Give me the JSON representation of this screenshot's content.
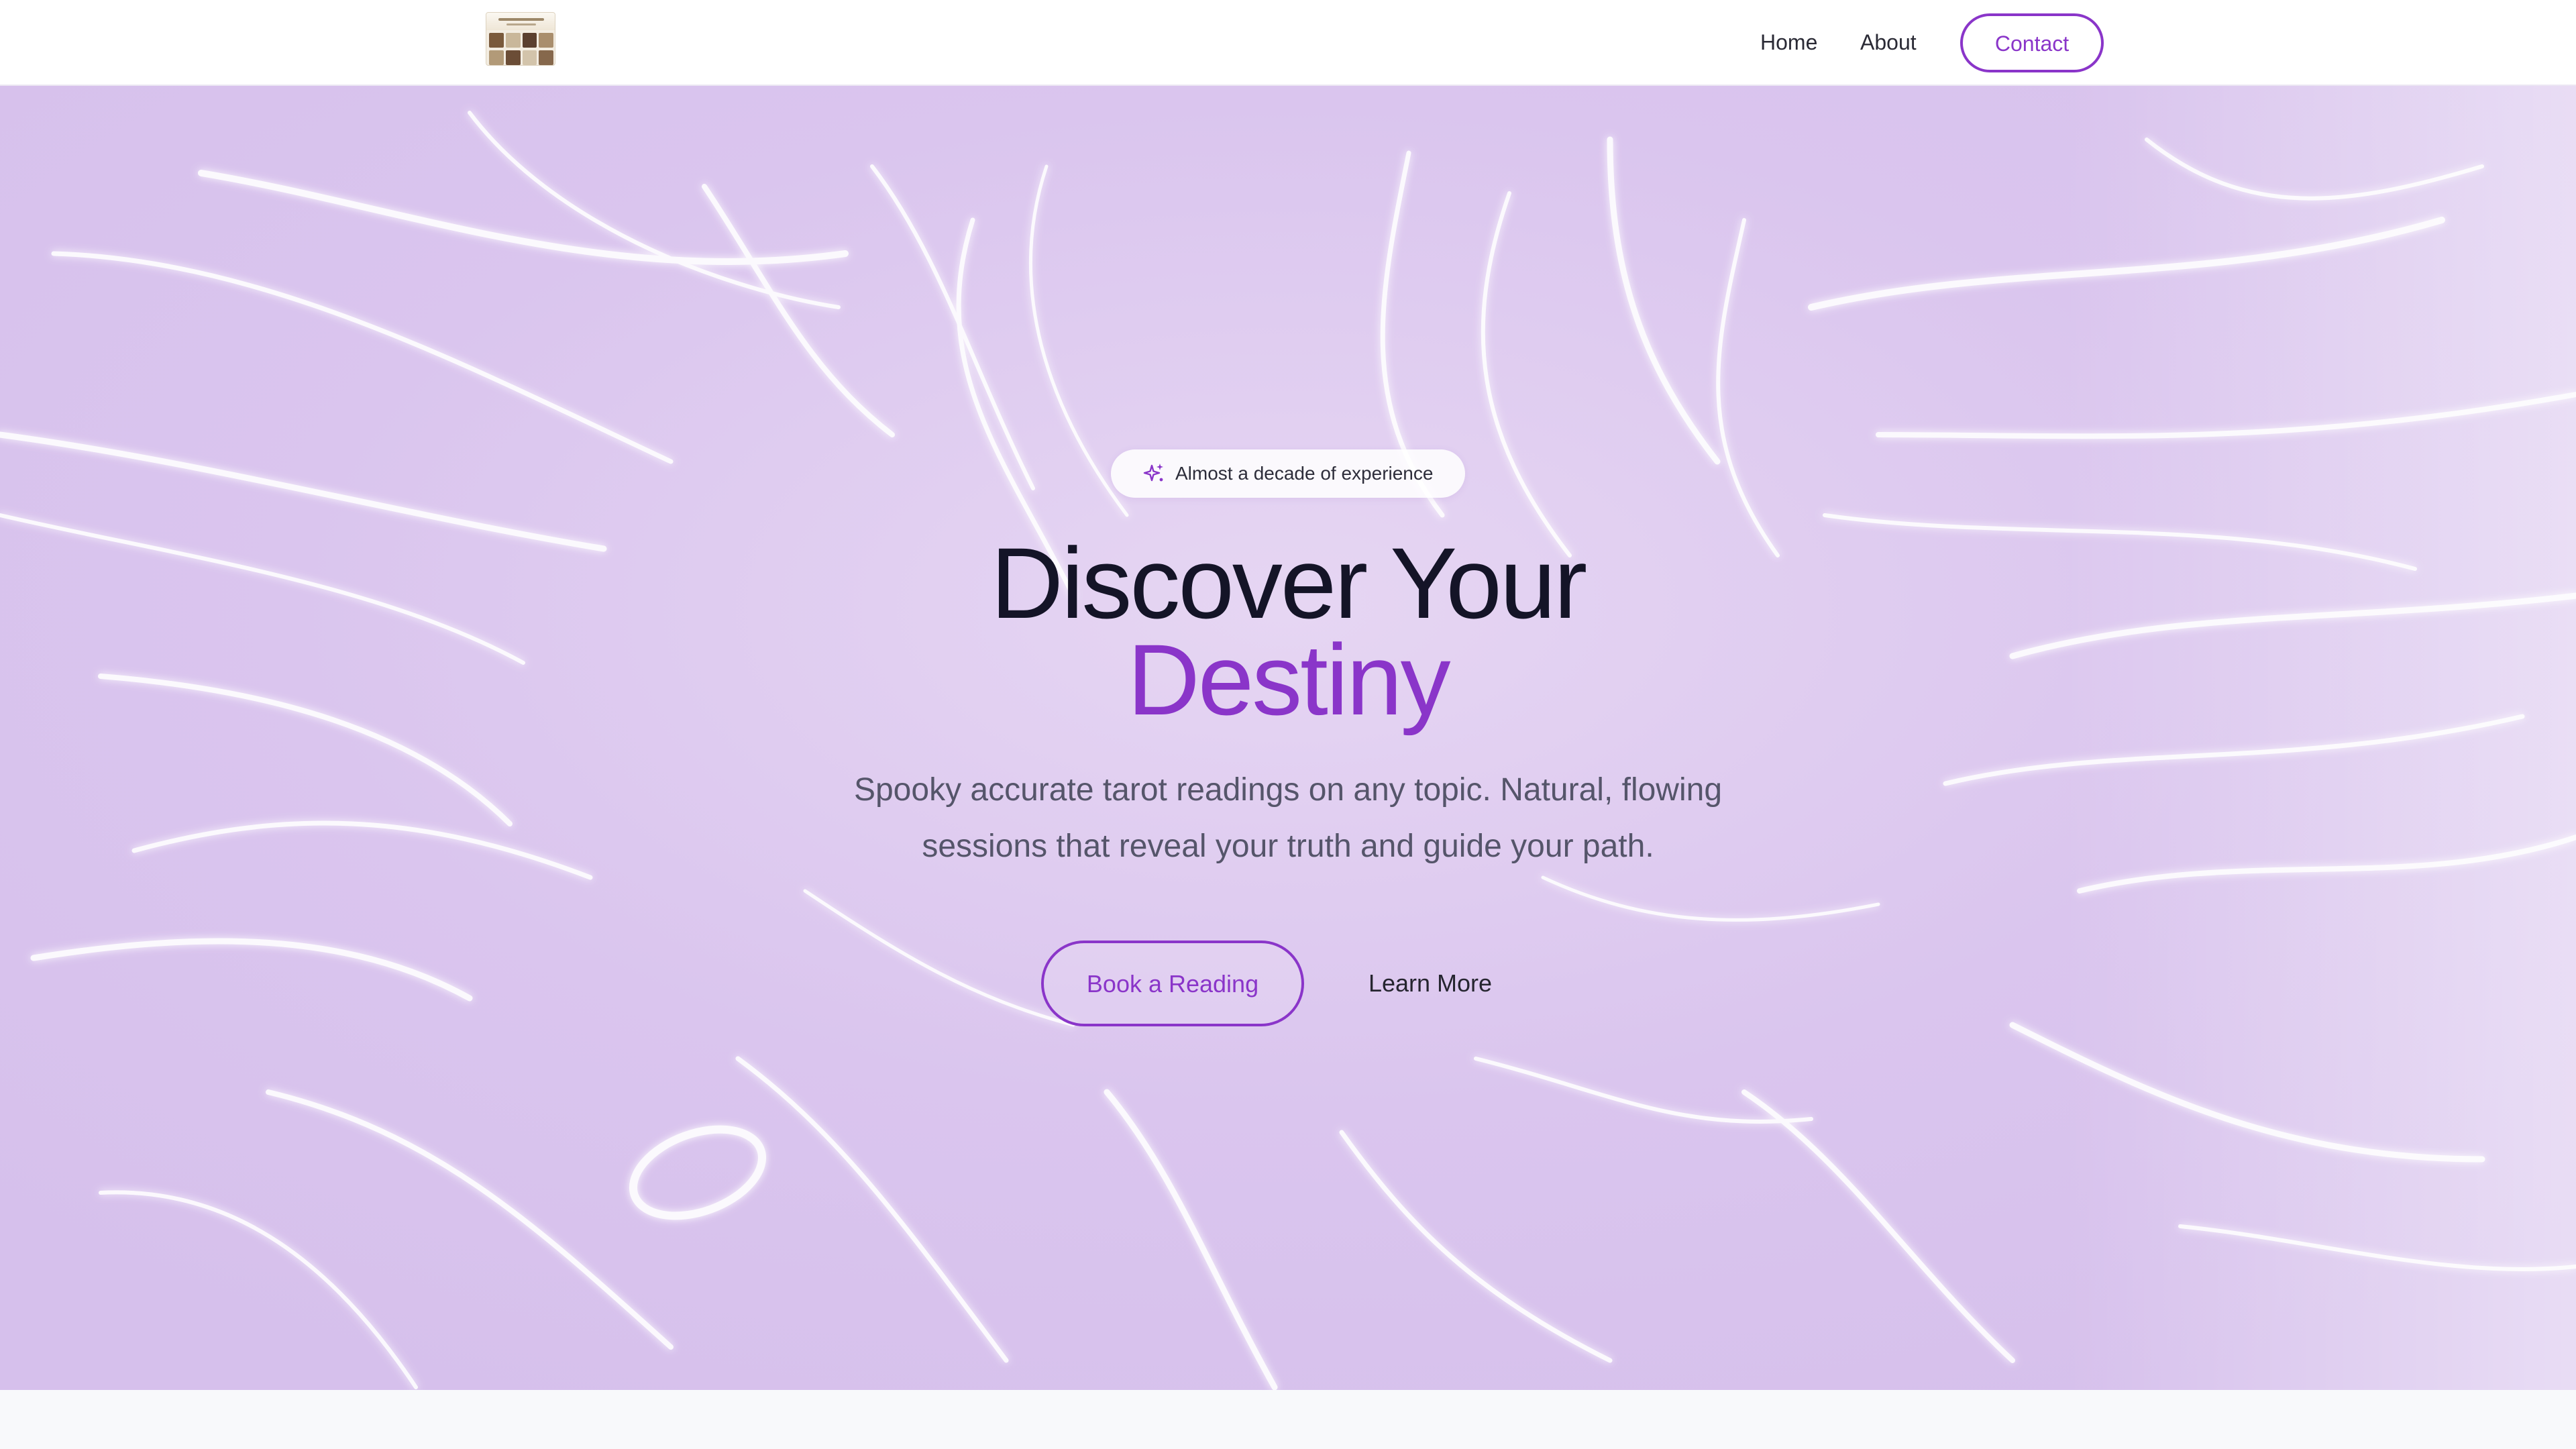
{
  "navbar": {
    "logo_alt": "logo",
    "links": [
      {
        "label": "Home"
      },
      {
        "label": "About"
      }
    ],
    "contact_label": "Contact"
  },
  "hero": {
    "badge_icon": "sparkles-icon",
    "badge_text": "Almost a decade of experience",
    "headline_line1": "Discover Your",
    "headline_line2": "Destiny",
    "subtext": "Spooky accurate tarot readings on any topic. Natural, flowing sessions that reveal your truth and guide your path.",
    "primary_cta": "Book a Reading",
    "secondary_cta": "Learn More"
  },
  "colors": {
    "accent": "#8a35c9",
    "heading": "#141427",
    "body_text": "#55556a",
    "hero_bg": "#dcc8ee",
    "page_bg": "#f8f9fb"
  }
}
